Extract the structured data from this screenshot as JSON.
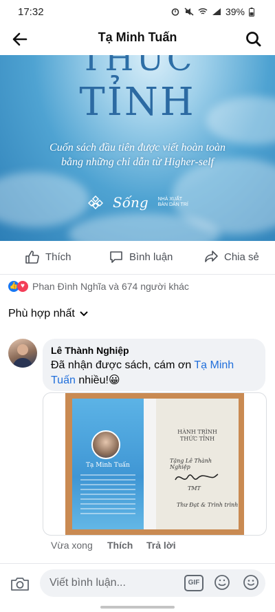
{
  "status": {
    "time": "17:32",
    "battery": "39%"
  },
  "header": {
    "title": "Tạ Minh Tuấn"
  },
  "banner": {
    "title_line1": "THỨC",
    "title_line2": "TỈNH",
    "subtitle_line1": "Cuốn sách đầu tiên được viết hoàn toàn",
    "subtitle_line2": "bằng những chỉ dẫn từ Higher-self",
    "logo_song": "Sống",
    "logo_nxb": "NHÀ XUẤT BẢN DÂN TRÍ"
  },
  "actions": {
    "like": "Thích",
    "comment": "Bình luận",
    "share": "Chia sẻ"
  },
  "reactions": {
    "text": "Phan Đình Nghĩa và 674 người khác"
  },
  "sort": {
    "label": "Phù hợp nhất"
  },
  "comment": {
    "author": "Lê Thành Nghiệp",
    "text_before": "Đã nhận được sách, cám ơn ",
    "mention": "Tạ Minh Tuấn",
    "text_after": " nhiều!😀",
    "time": "Vừa xong",
    "like": "Thích",
    "reply": "Trả lời",
    "book_author": "Tạ Minh Tuấn",
    "book_title_line1": "HÀNH TRÌNH",
    "book_title_line2": "THỨC TỈNH",
    "inscription_to": "Tặng Lê Thành Nghiệp",
    "inscription_sign": "TMT",
    "inscription_note": "Thư Đạt & Trình trình"
  },
  "composer": {
    "placeholder": "Viết bình luận...",
    "gif": "GIF"
  },
  "colors": {
    "link": "#216fdb",
    "like_blue": "#1877f2",
    "heart_red": "#f33e58"
  }
}
